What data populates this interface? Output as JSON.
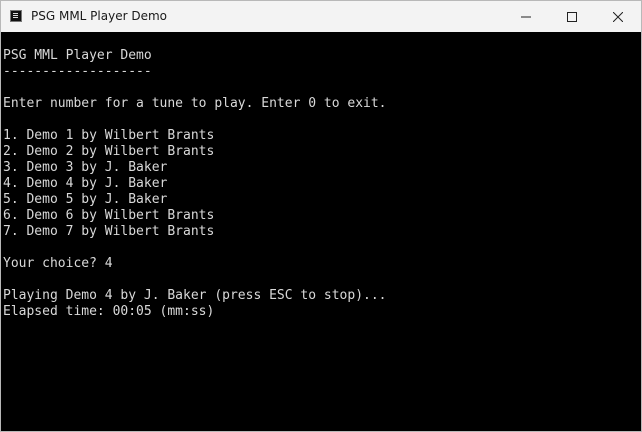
{
  "window": {
    "title": "PSG MML Player Demo"
  },
  "console": {
    "lines": [
      "PSG MML Player Demo",
      "-------------------",
      "",
      "Enter number for a tune to play. Enter 0 to exit.",
      "",
      "1. Demo 1 by Wilbert Brants",
      "2. Demo 2 by Wilbert Brants",
      "3. Demo 3 by J. Baker",
      "4. Demo 4 by J. Baker",
      "5. Demo 5 by J. Baker",
      "6. Demo 6 by Wilbert Brants",
      "7. Demo 7 by Wilbert Brants",
      "",
      "Your choice? 4",
      "",
      "Playing Demo 4 by J. Baker (press ESC to stop)...",
      "Elapsed time: 00:05 (mm:ss)"
    ]
  },
  "colors": {
    "console_background": "#000000",
    "console_text": "#d9d9d9",
    "titlebar_background": "#f3f3f3"
  },
  "icons": {
    "app": "console-app-icon",
    "minimize": "minimize-icon",
    "maximize": "maximize-icon",
    "close": "close-icon"
  }
}
